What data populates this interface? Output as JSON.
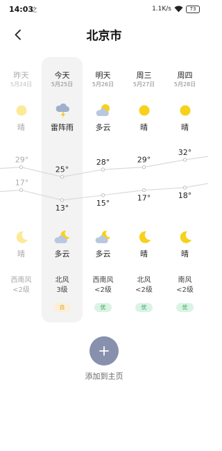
{
  "status_bar": {
    "time": "14:03",
    "extra_glyph": "之",
    "network_speed": "1.1K/s",
    "battery": "73"
  },
  "header": {
    "title": "北京市",
    "back_icon": "chevron-left-icon"
  },
  "days": [
    {
      "name": "昨天",
      "date": "5月24日",
      "day_icon": "sun-icon",
      "day_cond": "晴",
      "high": 29,
      "high_label": "29°",
      "low": 17,
      "low_label": "17°",
      "night_icon": "moon-icon",
      "night_cond": "晴",
      "wind_dir": "西南风",
      "wind_level": "<2级",
      "aqi": "",
      "dim": true
    },
    {
      "name": "今天",
      "date": "5月25日",
      "day_icon": "thunderstorm-icon",
      "day_cond": "雷阵雨",
      "high": 25,
      "high_label": "25°",
      "low": 13,
      "low_label": "13°",
      "night_icon": "moon-cloud-icon",
      "night_cond": "多云",
      "wind_dir": "北风",
      "wind_level": "3级",
      "aqi": "良",
      "aqi_color": "#e2a53a",
      "aqi_bg": "#fbefd7",
      "dim": false
    },
    {
      "name": "明天",
      "date": "5月26日",
      "day_icon": "sun-cloud-icon",
      "day_cond": "多云",
      "high": 28,
      "high_label": "28°",
      "low": 15,
      "low_label": "15°",
      "night_icon": "moon-cloud-icon",
      "night_cond": "多云",
      "wind_dir": "西南风",
      "wind_level": "<2级",
      "aqi": "优",
      "aqi_color": "#2ea55d",
      "aqi_bg": "#dbf3e4",
      "dim": false
    },
    {
      "name": "周三",
      "date": "5月27日",
      "day_icon": "sun-icon",
      "day_cond": "晴",
      "high": 29,
      "high_label": "29°",
      "low": 17,
      "low_label": "17°",
      "night_icon": "moon-icon",
      "night_cond": "晴",
      "wind_dir": "北风",
      "wind_level": "<2级",
      "aqi": "优",
      "aqi_color": "#2ea55d",
      "aqi_bg": "#dbf3e4",
      "dim": false
    },
    {
      "name": "周四",
      "date": "5月28日",
      "day_icon": "sun-icon",
      "day_cond": "晴",
      "high": 32,
      "high_label": "32°",
      "low": 18,
      "low_label": "18°",
      "night_icon": "moon-icon",
      "night_cond": "晴",
      "wind_dir": "南风",
      "wind_level": "<2级",
      "aqi": "优",
      "aqi_color": "#2ea55d",
      "aqi_bg": "#dbf3e4",
      "dim": false
    }
  ],
  "add_button": {
    "icon": "plus-icon",
    "label": "添加到主页"
  }
}
